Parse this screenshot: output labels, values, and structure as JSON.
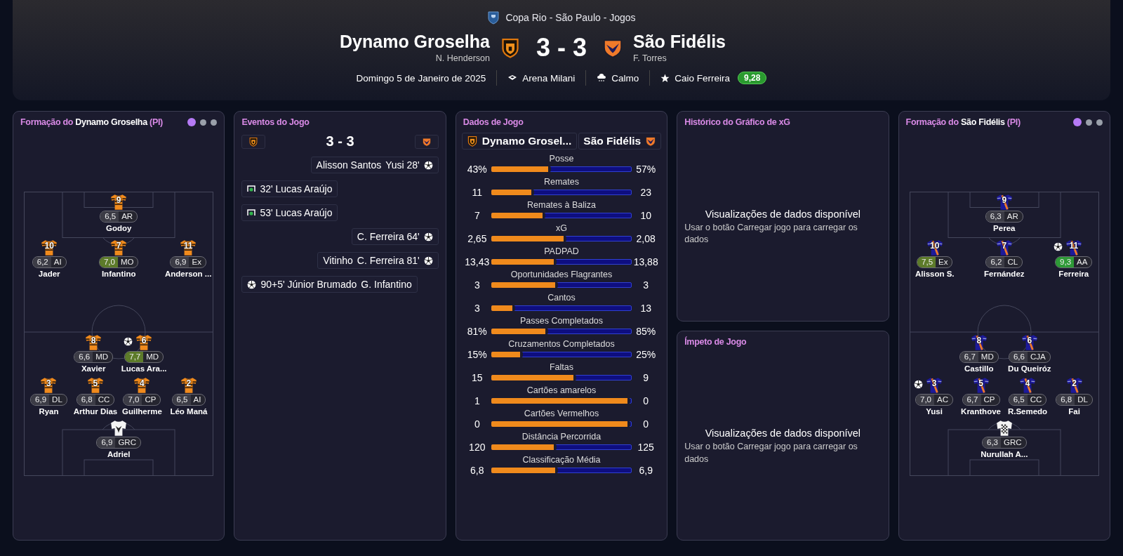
{
  "header": {
    "competition": "Copa Rio - São Paulo - Jogos",
    "home": {
      "name": "Dynamo Groselha",
      "manager": "N. Henderson"
    },
    "score": "3 - 3",
    "away": {
      "name": "São Fidélis",
      "manager": "F. Torres"
    },
    "date": "Domingo 5 de Janeiro de 2025",
    "venue": "Arena Milani",
    "weather": "Calmo",
    "star_player": "Caio Ferreira",
    "star_rating": "9,28"
  },
  "home_lineup": {
    "title_prefix": "Formação do",
    "team": "Dynamo Groselha",
    "suffix": "(PI)",
    "kind": "hoops",
    "pages": [
      {
        "selected": true
      },
      {
        "selected": false
      },
      {
        "selected": false
      }
    ],
    "lines": [
      [
        {
          "kind": "outfield",
          "number": "9",
          "rating": "6,5",
          "position": "AR",
          "name": "Godoy",
          "color": "#3c3c46",
          "scored": false
        }
      ],
      [
        {
          "kind": "outfield",
          "number": "10",
          "rating": "6,2",
          "position": "AI",
          "name": "Jader",
          "color": "#3c3c46",
          "scored": false
        },
        {
          "kind": "outfield",
          "number": "7",
          "rating": "7,0",
          "position": "MO",
          "name": "Infantino",
          "color": "#5d7b2a",
          "scored": false
        },
        {
          "kind": "outfield",
          "number": "11",
          "rating": "6,9",
          "position": "Ex",
          "name": "Anderson ...",
          "color": "#3c3c46",
          "scored": false
        }
      ],
      [
        {
          "kind": "outfield",
          "number": "8",
          "rating": "6,6",
          "position": "MD",
          "name": "Xavier",
          "color": "#3c3c46",
          "scored": false
        },
        {
          "kind": "outfield",
          "number": "6",
          "rating": "7,7",
          "position": "MD",
          "name": "Lucas Ara...",
          "color": "#5d7b2a",
          "scored": true
        }
      ],
      [
        {
          "kind": "outfield",
          "number": "3",
          "rating": "6,9",
          "position": "DL",
          "name": "Ryan",
          "color": "#3c3c46",
          "scored": false
        },
        {
          "kind": "outfield",
          "number": "5",
          "rating": "6,8",
          "position": "CC",
          "name": "Arthur Dias",
          "color": "#3c3c46",
          "scored": false
        },
        {
          "kind": "outfield",
          "number": "4",
          "rating": "7,0",
          "position": "CP",
          "name": "Guilherme",
          "color": "#3c3c46",
          "scored": false
        },
        {
          "kind": "outfield",
          "number": "2",
          "rating": "6,5",
          "position": "AI",
          "name": "Léo Maná",
          "color": "#3c3c46",
          "scored": false
        }
      ],
      [
        {
          "kind": "goalkeeper",
          "rating": "6,9",
          "position": "GRC",
          "name": "Adriel",
          "color": "#3c3c46",
          "scored": false
        }
      ]
    ]
  },
  "events": {
    "title": "Eventos do Jogo",
    "score": "3 - 3",
    "items": [
      {
        "kind": "away-ball",
        "texts": [
          "Alisson Santos",
          "Yusi 28'"
        ]
      },
      {
        "kind": "home-net",
        "texts": [
          "32' Lucas Araújo"
        ]
      },
      {
        "kind": "home-net",
        "texts": [
          "53' Lucas Araújo"
        ]
      },
      {
        "kind": "away-ball",
        "texts": [
          "C. Ferreira 64'"
        ]
      },
      {
        "kind": "away-ball",
        "texts": [
          "Vitinho",
          "C. Ferreira 81'"
        ]
      },
      {
        "kind": "home-ball",
        "texts": [
          "90+5' Júnior Brumado",
          "G. Infantino"
        ]
      }
    ]
  },
  "stats": {
    "title": "Dados de Jogo",
    "home_team": "Dynamo Grosel...",
    "away_team": "São Fidélis",
    "rows": [
      {
        "label": "Posse",
        "home": "43%",
        "away": "57%",
        "level": 0.43
      },
      {
        "label": "Remates",
        "home": "11",
        "away": "23",
        "level": 0.31
      },
      {
        "label": "Remates à Baliza",
        "home": "7",
        "away": "10",
        "level": 0.39
      },
      {
        "label": "xG",
        "home": "2,65",
        "away": "2,08",
        "level": 0.54
      },
      {
        "label": "PADPAD",
        "home": "13,43",
        "away": "13,88",
        "level": 0.47
      },
      {
        "label": "Oportunidades Flagrantes",
        "home": "3",
        "away": "3",
        "level": 0.48
      },
      {
        "label": "Cantos",
        "home": "3",
        "away": "13",
        "level": 0.17
      },
      {
        "label": "Passes Completados",
        "home": "81%",
        "away": "85%",
        "level": 0.41
      },
      {
        "label": "Cruzamentos Completados",
        "home": "15%",
        "away": "25%",
        "level": 0.23
      },
      {
        "label": "Faltas",
        "home": "15",
        "away": "9",
        "level": 0.61
      },
      {
        "label": "Cartões amarelos",
        "home": "1",
        "away": "0",
        "level": 1
      },
      {
        "label": "Cartões Vermelhos",
        "home": "0",
        "away": "0",
        "level": 1
      },
      {
        "label": "Distância Percorrida",
        "home": "120",
        "away": "125",
        "level": 0.47
      },
      {
        "label": "Classificação Média",
        "home": "6,8",
        "away": "6,9",
        "level": 0.48
      }
    ]
  },
  "charts": [
    {
      "title": "Histórico do Gráfico de xG",
      "heading": "Visualizações de dados disponível",
      "message": "Usar o botão Carregar jogo para carregar os dados"
    },
    {
      "title": "Ímpeto de Jogo",
      "heading": "Visualizações de dados disponível",
      "message": "Usar o botão Carregar jogo para carregar os dados"
    }
  ],
  "away_lineup": {
    "title_prefix": "Formação do",
    "team": "São Fidélis",
    "suffix": "(PI)",
    "kind": "sash",
    "pages": [
      {
        "selected": true
      },
      {
        "selected": false
      },
      {
        "selected": false
      }
    ],
    "lines": [
      [
        {
          "kind": "outfield",
          "number": "9",
          "rating": "6,3",
          "position": "AR",
          "name": "Perea",
          "color": "#3c3c46",
          "scored": false
        }
      ],
      [
        {
          "kind": "outfield",
          "number": "10",
          "rating": "7,5",
          "position": "Ex",
          "name": "Alisson S.",
          "color": "#5d7b2a",
          "scored": false
        },
        {
          "kind": "outfield",
          "number": "7",
          "rating": "6,2",
          "position": "CL",
          "name": "Fernández",
          "color": "#3c3c46",
          "scored": false
        },
        {
          "kind": "outfield",
          "number": "11",
          "rating": "9,3",
          "position": "AA",
          "name": "Ferreira",
          "color": "#2e9a37",
          "scored": true
        }
      ],
      [
        {
          "kind": "outfield",
          "number": "8",
          "rating": "6,7",
          "position": "MD",
          "name": "Castillo",
          "color": "#3c3c46",
          "scored": false
        },
        {
          "kind": "outfield",
          "number": "6",
          "rating": "6,6",
          "position": "CJA",
          "name": "Du Queiróz",
          "color": "#3c3c46",
          "scored": false
        }
      ],
      [
        {
          "kind": "outfield",
          "number": "3",
          "rating": "7,0",
          "position": "AC",
          "name": "Yusi",
          "color": "#3c3c46",
          "scored": true
        },
        {
          "kind": "outfield",
          "number": "5",
          "rating": "6,7",
          "position": "CP",
          "name": "Kranthove",
          "color": "#3c3c46",
          "scored": false
        },
        {
          "kind": "outfield",
          "number": "4",
          "rating": "6,5",
          "position": "CC",
          "name": "R.Semedo",
          "color": "#3c3c46",
          "scored": false
        },
        {
          "kind": "outfield",
          "number": "2",
          "rating": "6,8",
          "position": "DL",
          "name": "Fai",
          "color": "#3c3c46",
          "scored": false
        }
      ],
      [
        {
          "kind": "goalkeeper",
          "rating": "6,3",
          "position": "GRC",
          "name": "Nurullah A...",
          "color": "#3c3c46",
          "scored": false
        }
      ]
    ]
  }
}
